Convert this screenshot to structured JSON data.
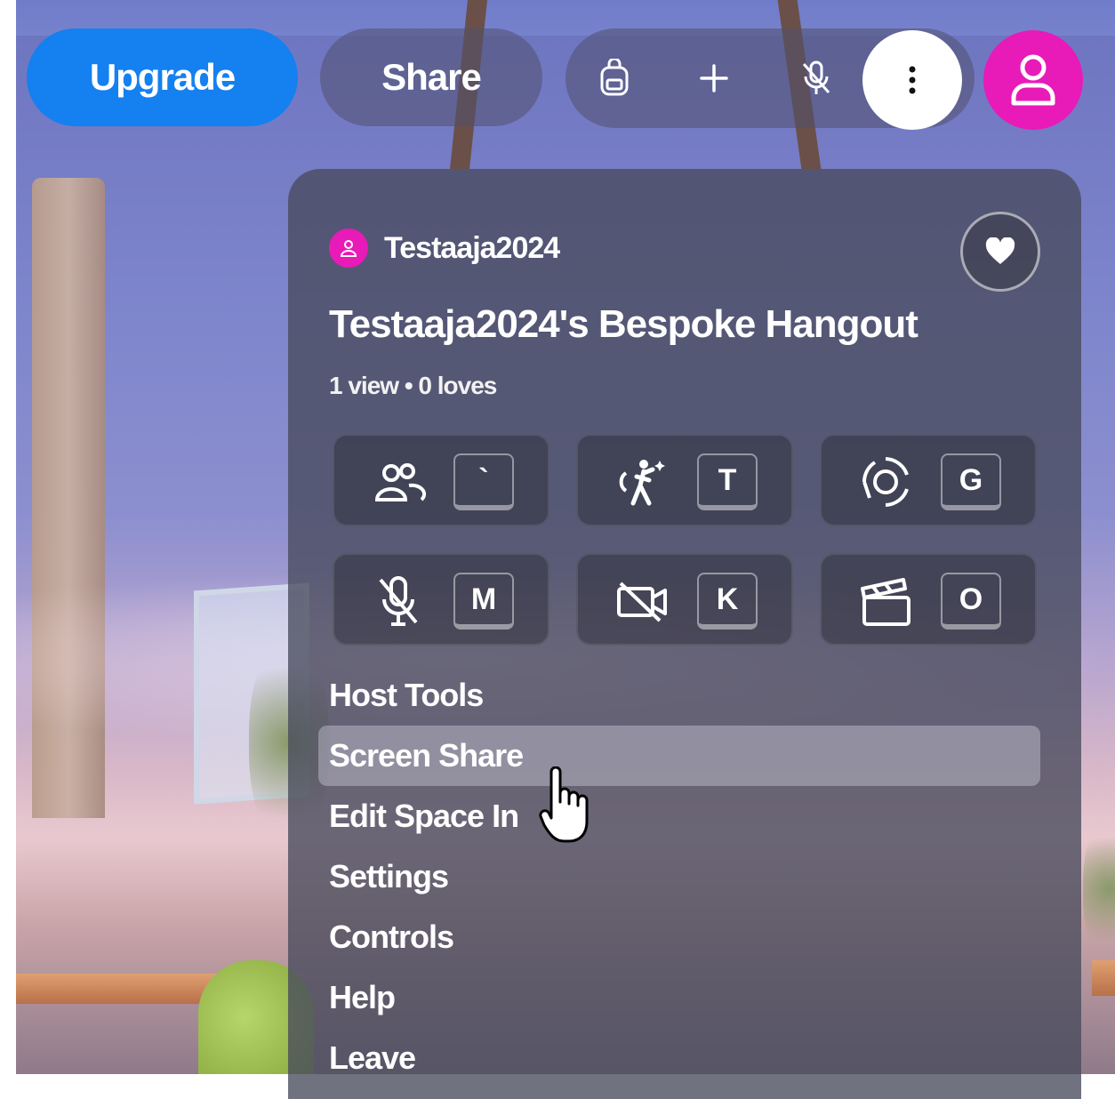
{
  "toolbar": {
    "upgrade_label": "Upgrade",
    "share_label": "Share",
    "icons": [
      "backpack-icon",
      "plus-icon",
      "mic-muted-icon",
      "more-vertical-icon",
      "user-icon"
    ]
  },
  "space": {
    "owner": "Testaaja2024",
    "title": "Testaaja2024's Bespoke Hangout",
    "stats": "1 view • 0 loves"
  },
  "quick_actions": [
    {
      "icon": "people-icon",
      "key": "`"
    },
    {
      "icon": "dance-icon",
      "key": "T"
    },
    {
      "icon": "gravity-icon",
      "key": "G"
    },
    {
      "icon": "mic-muted-icon",
      "key": "M"
    },
    {
      "icon": "camera-off-icon",
      "key": "K"
    },
    {
      "icon": "clapperboard-icon",
      "key": "O"
    }
  ],
  "menu": {
    "items": [
      {
        "label": "Host Tools"
      },
      {
        "label": "Screen Share"
      },
      {
        "label": "Edit Space In"
      },
      {
        "label": "Settings"
      },
      {
        "label": "Controls"
      },
      {
        "label": "Help"
      },
      {
        "label": "Leave"
      }
    ],
    "hovered": "Screen Share"
  },
  "colors": {
    "upgrade": "#1580f0",
    "avatar": "#e81ab8",
    "panel": "#484a5c"
  }
}
